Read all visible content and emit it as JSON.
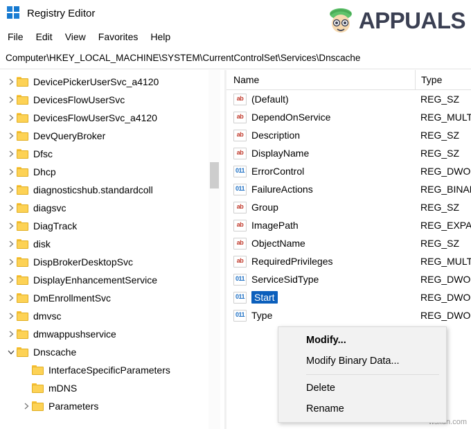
{
  "window": {
    "title": "Registry Editor",
    "icon": "registry-editor-icon"
  },
  "watermark": {
    "brand": "APPUALS",
    "bottom_right": "wsxdn.com"
  },
  "menu": {
    "items": [
      "File",
      "Edit",
      "View",
      "Favorites",
      "Help"
    ]
  },
  "address": {
    "path": "Computer\\HKEY_LOCAL_MACHINE\\SYSTEM\\CurrentControlSet\\Services\\Dnscache"
  },
  "tree": {
    "items": [
      {
        "label": "DevicePickerUserSvc_a4120",
        "indent": 1,
        "expandable": true,
        "expanded": false
      },
      {
        "label": "DevicesFlowUserSvc",
        "indent": 1,
        "expandable": true,
        "expanded": false
      },
      {
        "label": "DevicesFlowUserSvc_a4120",
        "indent": 1,
        "expandable": true,
        "expanded": false
      },
      {
        "label": "DevQueryBroker",
        "indent": 1,
        "expandable": true,
        "expanded": false
      },
      {
        "label": "Dfsc",
        "indent": 1,
        "expandable": true,
        "expanded": false
      },
      {
        "label": "Dhcp",
        "indent": 1,
        "expandable": true,
        "expanded": false
      },
      {
        "label": "diagnosticshub.standardcoll",
        "indent": 1,
        "expandable": true,
        "expanded": false
      },
      {
        "label": "diagsvc",
        "indent": 1,
        "expandable": true,
        "expanded": false
      },
      {
        "label": "DiagTrack",
        "indent": 1,
        "expandable": true,
        "expanded": false
      },
      {
        "label": "disk",
        "indent": 1,
        "expandable": true,
        "expanded": false
      },
      {
        "label": "DispBrokerDesktopSvc",
        "indent": 1,
        "expandable": true,
        "expanded": false
      },
      {
        "label": "DisplayEnhancementService",
        "indent": 1,
        "expandable": true,
        "expanded": false
      },
      {
        "label": "DmEnrollmentSvc",
        "indent": 1,
        "expandable": true,
        "expanded": false
      },
      {
        "label": "dmvsc",
        "indent": 1,
        "expandable": true,
        "expanded": false
      },
      {
        "label": "dmwappushservice",
        "indent": 1,
        "expandable": true,
        "expanded": false
      },
      {
        "label": "Dnscache",
        "indent": 1,
        "expandable": true,
        "expanded": true
      },
      {
        "label": "InterfaceSpecificParameters",
        "indent": 2,
        "expandable": false,
        "expanded": false
      },
      {
        "label": "mDNS",
        "indent": 2,
        "expandable": false,
        "expanded": false
      },
      {
        "label": "Parameters",
        "indent": 2,
        "expandable": true,
        "expanded": false
      }
    ]
  },
  "values": {
    "columns": {
      "name": "Name",
      "type": "Type"
    },
    "rows": [
      {
        "name": "(Default)",
        "type": "REG_SZ",
        "icon": "string-value-icon",
        "selected": false
      },
      {
        "name": "DependOnService",
        "type": "REG_MULTI_SZ",
        "icon": "string-value-icon",
        "selected": false
      },
      {
        "name": "Description",
        "type": "REG_SZ",
        "icon": "string-value-icon",
        "selected": false
      },
      {
        "name": "DisplayName",
        "type": "REG_SZ",
        "icon": "string-value-icon",
        "selected": false
      },
      {
        "name": "ErrorControl",
        "type": "REG_DWORD",
        "icon": "binary-value-icon",
        "selected": false
      },
      {
        "name": "FailureActions",
        "type": "REG_BINARY",
        "icon": "binary-value-icon",
        "selected": false
      },
      {
        "name": "Group",
        "type": "REG_SZ",
        "icon": "string-value-icon",
        "selected": false
      },
      {
        "name": "ImagePath",
        "type": "REG_EXPAND_SZ",
        "icon": "string-value-icon",
        "selected": false
      },
      {
        "name": "ObjectName",
        "type": "REG_SZ",
        "icon": "string-value-icon",
        "selected": false
      },
      {
        "name": "RequiredPrivileges",
        "type": "REG_MULTI_SZ",
        "icon": "string-value-icon",
        "selected": false
      },
      {
        "name": "ServiceSidType",
        "type": "REG_DWORD",
        "icon": "binary-value-icon",
        "selected": false
      },
      {
        "name": "Start",
        "type": "REG_DWORD",
        "icon": "binary-value-icon",
        "selected": true
      },
      {
        "name": "Type",
        "type": "REG_DWORD",
        "icon": "binary-value-icon",
        "selected": false
      }
    ]
  },
  "context_menu": {
    "items": [
      {
        "label": "Modify...",
        "bold": true,
        "separator_after": false
      },
      {
        "label": "Modify Binary Data...",
        "bold": false,
        "separator_after": true
      },
      {
        "label": "Delete",
        "bold": false,
        "separator_after": false
      },
      {
        "label": "Rename",
        "bold": false,
        "separator_after": false
      }
    ]
  },
  "colors": {
    "selection": "#0b5fbc",
    "folder": "#fdd255",
    "accent": "#1e7fd4"
  }
}
